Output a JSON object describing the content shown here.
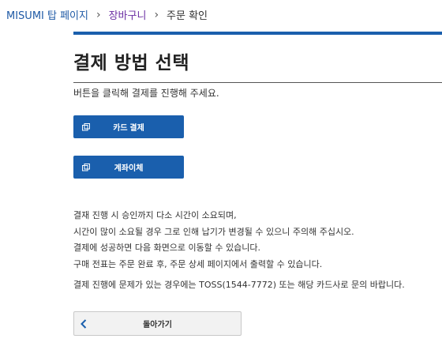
{
  "breadcrumb": {
    "items": [
      {
        "label": "MISUMI 탑 페이지"
      },
      {
        "label": "장바구니"
      },
      {
        "label": "주문 확인"
      }
    ],
    "separator": "›"
  },
  "page": {
    "title": "결제 방법 선택",
    "instruction": "버튼을 클릭해 결제를 진행해 주세요."
  },
  "payment_buttons": [
    {
      "label": "카드 결제",
      "icon": "copy-icon"
    },
    {
      "label": "계좌이체",
      "icon": "copy-icon"
    }
  ],
  "notice": {
    "lines": [
      "결재 진행 시 승인까지 다소 시간이 소요되며,",
      "시간이 많이 소요될 경우 그로 인해 납기가 변경될 수 있으니 주의해 주십시오.",
      "결제에 성공하면 다음 화면으로 이동할 수 있습니다.",
      "구매 전표는 주문 완료 후, 주문 상세 페이지에서 출력할 수 있습니다."
    ],
    "contact": "결제 진행에 문제가 있는 경우에는 TOSS(1544-7772) 또는 해당 카드사로 문의 바랍니다."
  },
  "back_button": {
    "label": "돌아가기",
    "icon": "chevron-left-icon"
  },
  "colors": {
    "accent": "#1a5fad",
    "link": "#1f5aa6",
    "visited": "#6b2fa3"
  }
}
